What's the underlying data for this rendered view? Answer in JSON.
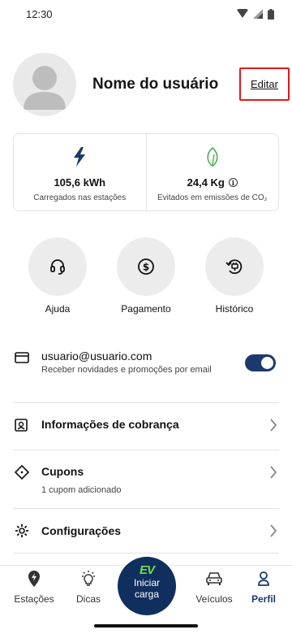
{
  "status_bar": {
    "time": "12:30"
  },
  "profile": {
    "name": "Nome do usuário",
    "edit_label": "Editar"
  },
  "stats": [
    {
      "value": "105,6 kWh",
      "label": "Carregados nas estações",
      "icon": "lightning-icon",
      "color": "#1b3a6b"
    },
    {
      "value": "24,4 Kg",
      "label": "Evitados em emissões de CO₂",
      "icon": "leaf-icon",
      "color": "#4caf50"
    }
  ],
  "shortcuts": [
    {
      "label": "Ajuda",
      "icon": "headset-icon"
    },
    {
      "label": "Pagamento",
      "icon": "dollar-coin-icon"
    },
    {
      "label": "Histórico",
      "icon": "history-plug-icon"
    }
  ],
  "email": {
    "address": "usuario@usuario.com",
    "subtitle": "Receber novidades e promoções por email",
    "toggle_on": true
  },
  "menu": [
    {
      "title": "Informações de cobrança",
      "subtitle": "",
      "icon": "id-card-icon"
    },
    {
      "title": "Cupons",
      "subtitle": "1 cupom adicionado",
      "icon": "coupon-icon"
    },
    {
      "title": "Configurações",
      "subtitle": "",
      "icon": "gear-icon"
    }
  ],
  "bottom_nav": {
    "stations": "Estações",
    "tips": "Dicas",
    "start_logo": "EV",
    "start_line1": "Iniciar",
    "start_line2": "carga",
    "vehicles": "Veículos",
    "profile": "Perfil"
  },
  "colors": {
    "primary": "#1b3a6b",
    "accent_green": "#6be04a",
    "edit_border": "#e11a1a"
  }
}
